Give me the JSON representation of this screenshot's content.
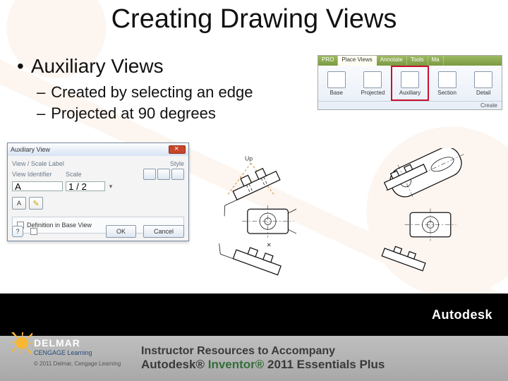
{
  "title": "Creating Drawing Views",
  "bullet1": "Auxiliary Views",
  "sub_a": "Created by selecting an edge",
  "sub_b": "Projected at 90  degrees",
  "ribbon": {
    "tab_pro": "PRO",
    "tab_place": "Place Views",
    "tab_annotate": "Annotate",
    "tab_tools": "Tools",
    "tab_ma": "Ma",
    "icon_base": "Base",
    "icon_projected": "Projected",
    "icon_auxiliary": "Auxiliary",
    "icon_section": "Section",
    "icon_detail": "Detail",
    "panel": "Create"
  },
  "dialog": {
    "title": "Auxiliary View",
    "group": "View / Scale Label",
    "lbl_id": "View Identifier",
    "lbl_scale": "Scale",
    "val_id": "A",
    "val_scale": "1 / 2",
    "lbl_style": "Style",
    "chk_def": "Definition in Base View",
    "chk_small": "",
    "ok": "OK",
    "cancel": "Cancel"
  },
  "drawlabel_up": "Up",
  "footer": {
    "autodesk": "Autodesk",
    "delmar": "DELMAR",
    "cengage": "CENGAGE Learning",
    "copyright": "© 2011 Delmar, Cengage Learning",
    "line1": "Instructor Resources to Accompany",
    "line2_a": "Autodesk® ",
    "line2_b": "Inventor®",
    "line2_c": " 2011 ",
    "line2_d": "Essentials Plus"
  }
}
